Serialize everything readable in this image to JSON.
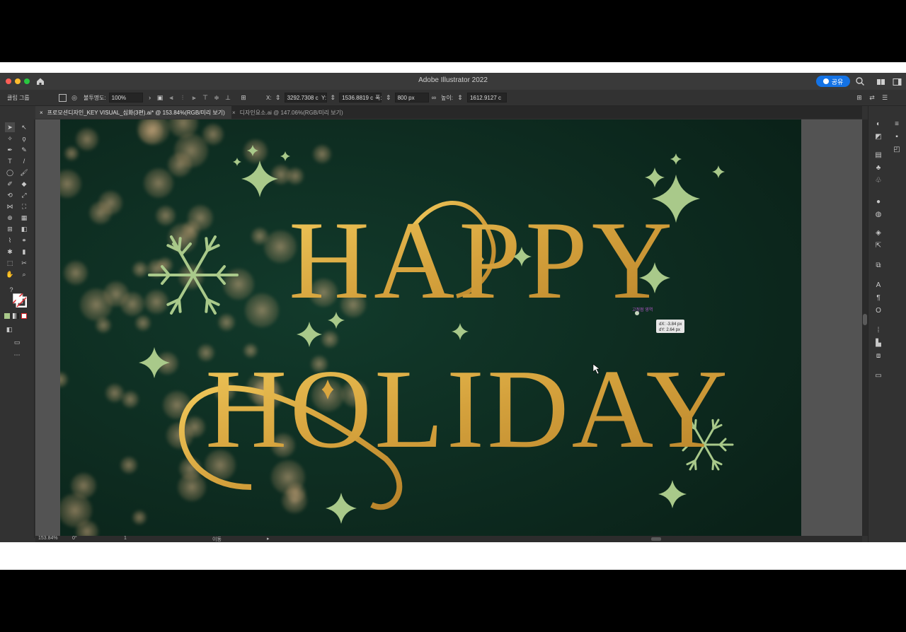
{
  "window": {
    "title": "Adobe Illustrator 2022",
    "share_label": "공유"
  },
  "control_bar": {
    "selection_label": "클립 그룹",
    "opacity_label": "불투명도:",
    "opacity_value": "100%",
    "x_label": "X:",
    "x_value": "3292.7308 c",
    "y_label": "Y:",
    "y_value": "1536.8819 c",
    "w_label": "폭:",
    "w_value": "800 px",
    "h_label": "높이:",
    "h_value": "1612.9127 c"
  },
  "tabs": [
    {
      "label": "프로모션디자인_KEY VISUAL_심화(3편).ai* @ 153.84%(RGB/미리 보기)",
      "active": true
    },
    {
      "label": "디자인요소.ai @ 147.06%(RGB/미리 보기)",
      "active": false
    }
  ],
  "artwork": {
    "line1": "HAPPY",
    "line2": "HOLIDAY",
    "bg_color": "#0d2a1f",
    "gold": "#d9a63f",
    "sparkle_color": "#a9c98a",
    "smart_guide_label": "고정점 영역",
    "delta_x": "dX: -3.84 px",
    "delta_y": "dY: 2.64 px"
  },
  "status_bar": {
    "zoom": "153.84%",
    "rotation": "0°",
    "artboard_num": "1",
    "mode": "이동"
  },
  "colors": {
    "accent": "#1473e6",
    "panel": "#323232",
    "dark": "#262626"
  }
}
